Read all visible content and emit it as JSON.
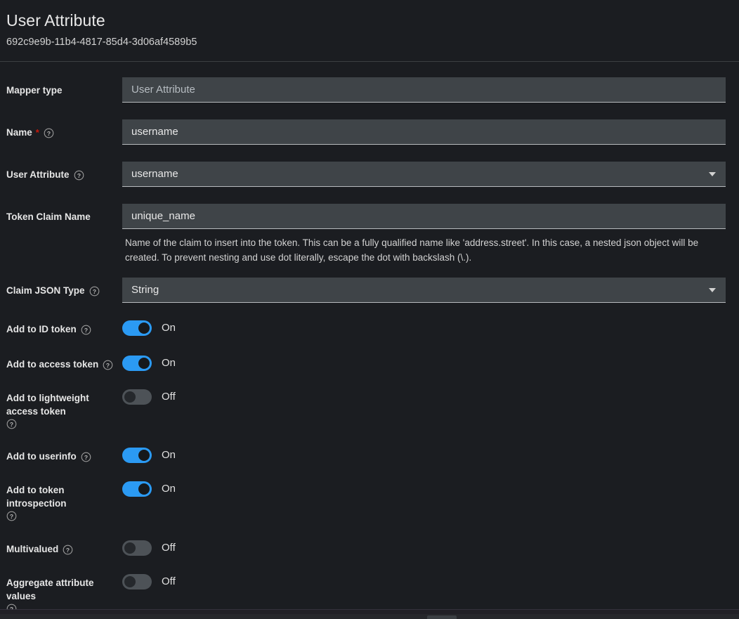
{
  "header": {
    "title": "User Attribute",
    "id": "692c9e9b-11b4-4817-85d4-3d06af4589b5"
  },
  "form": {
    "mapper_type": {
      "label": "Mapper type",
      "value": "User Attribute"
    },
    "name": {
      "label": "Name",
      "required_marker": "*",
      "value": "username"
    },
    "user_attribute": {
      "label": "User Attribute",
      "value": "username"
    },
    "token_claim_name": {
      "label": "Token Claim Name",
      "value": "unique_name",
      "help": "Name of the claim to insert into the token. This can be a fully qualified name like 'address.street'. In this case, a nested json object will be created. To prevent nesting and use dot literally, escape the dot with backslash (\\.)."
    },
    "claim_json_type": {
      "label": "Claim JSON Type",
      "value": "String"
    },
    "toggles": [
      {
        "label": "Add to ID token",
        "state": "On",
        "on": true
      },
      {
        "label": "Add to access token",
        "state": "On",
        "on": true
      },
      {
        "label": "Add to lightweight access token",
        "state": "Off",
        "on": false
      },
      {
        "label": "Add to userinfo",
        "state": "On",
        "on": true
      },
      {
        "label": "Add to token introspection",
        "state": "On",
        "on": true
      },
      {
        "label": "Multivalued",
        "state": "Off",
        "on": false
      },
      {
        "label": "Aggregate attribute values",
        "state": "Off",
        "on": false
      }
    ]
  },
  "colors": {
    "background": "#1b1d21",
    "input_bg": "#3f4448",
    "toggle_on": "#2b9af3",
    "toggle_off": "#4d5257",
    "required": "#c9190b"
  }
}
